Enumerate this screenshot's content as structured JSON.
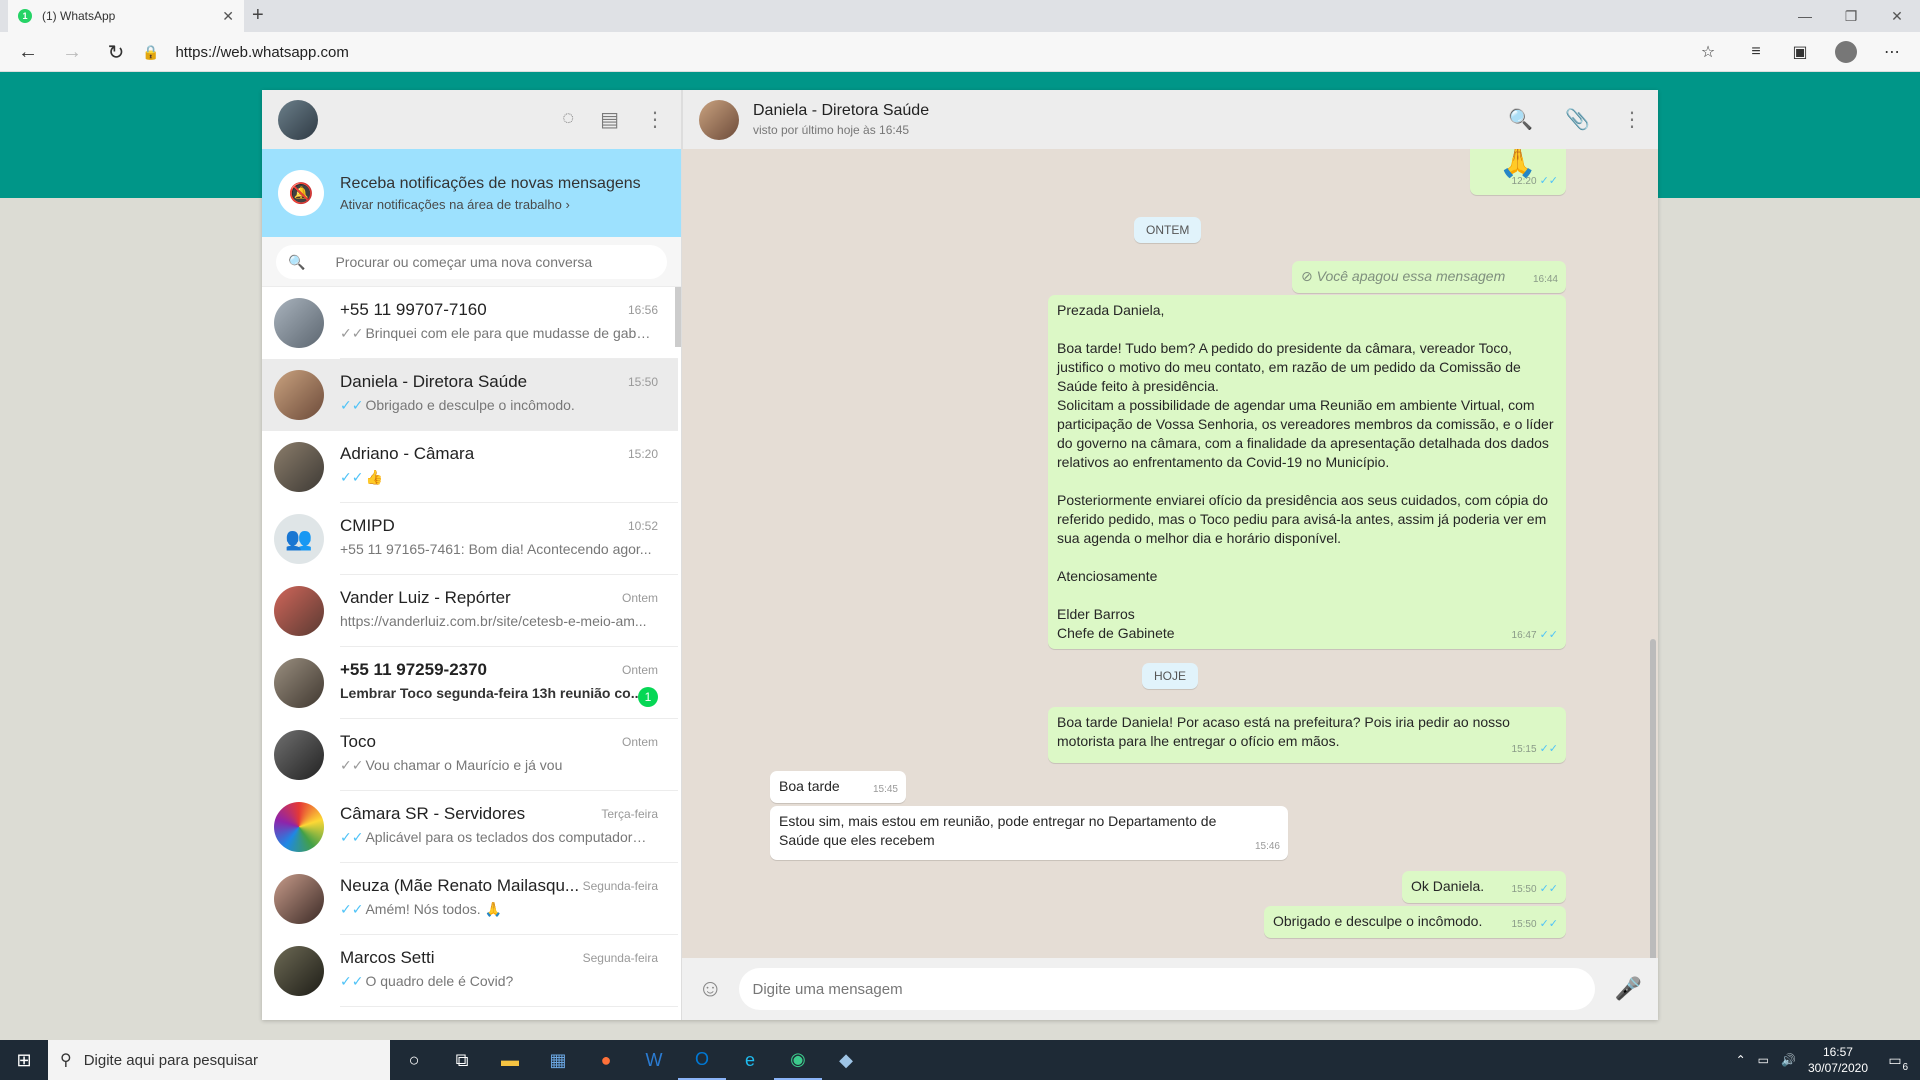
{
  "browser": {
    "tab_title": "(1) WhatsApp",
    "tab_favicon_badge": "1",
    "url": "https://web.whatsapp.com"
  },
  "sidebar": {
    "notification": {
      "title": "Receba notificações de novas mensagens",
      "subtitle": "Ativar notificações na área de trabalho ›"
    },
    "search_placeholder": "Procurar ou começar uma nova conversa",
    "chats": [
      {
        "name": "+55 11 99707-7160",
        "time": "16:56",
        "last": "Brinquei com ele para que mudasse de gabin...",
        "ticks": "✓✓",
        "ticks_color": "grey"
      },
      {
        "name": "Daniela - Diretora Saúde",
        "time": "15:50",
        "last": "Obrigado e desculpe o incômodo.",
        "ticks": "✓✓",
        "ticks_color": "blue"
      },
      {
        "name": "Adriano - Câmara",
        "time": "15:20",
        "last": "👍",
        "ticks": "✓✓",
        "ticks_color": "blue"
      },
      {
        "name": "CMIPD",
        "time": "10:52",
        "last": "+55 11 97165-7461: Bom dia! Acontecendo agor...",
        "ticks": "",
        "ticks_color": "none"
      },
      {
        "name": "Vander Luiz - Repórter",
        "time": "Ontem",
        "last": "https://vanderluiz.com.br/site/cetesb-e-meio-am...",
        "ticks": "",
        "ticks_color": "none"
      },
      {
        "name": "+55 11 97259-2370",
        "time": "Ontem",
        "last": "Lembrar Toco segunda-feira 13h reunião co...",
        "ticks": "",
        "ticks_color": "none",
        "unread": "1"
      },
      {
        "name": "Toco",
        "time": "Ontem",
        "last": "Vou chamar o Maurício e já vou",
        "ticks": "✓✓",
        "ticks_color": "grey"
      },
      {
        "name": "Câmara SR - Servidores",
        "time": "Terça-feira",
        "last": "Aplicável para os teclados dos computadores ...",
        "ticks": "✓✓",
        "ticks_color": "blue"
      },
      {
        "name": "Neuza (Mãe Renato Mailasqu...",
        "time": "Segunda-feira",
        "last": "Amém! Nós todos. 🙏",
        "ticks": "✓✓",
        "ticks_color": "blue"
      },
      {
        "name": "Marcos Setti",
        "time": "Segunda-feira",
        "last": "O quadro dele é Covid?",
        "ticks": "✓✓",
        "ticks_color": "blue"
      }
    ]
  },
  "conversation": {
    "name": "Daniela - Diretora Saúde",
    "status": "visto por último hoje às 16:45",
    "messages": {
      "emoji_msg": {
        "emoji": "🙏",
        "time": "12:20"
      },
      "day1": "ONTEM",
      "deleted": {
        "text": "Você apagou essa mensagem",
        "time": "16:44"
      },
      "long": {
        "text": "Prezada Daniela,\n\nBoa tarde! Tudo bem? A pedido do presidente da câmara, vereador Toco, justifico o motivo do meu contato, em razão de um pedido da Comissão de Saúde feito à presidência.\nSolicitam a possibilidade de agendar uma Reunião em ambiente Virtual, com participação de Vossa Senhoria, os vereadores membros da comissão, e o líder do governo na câmara, com a finalidade da apresentação detalhada dos dados relativos ao enfrentamento da Covid-19 no Município.\n\nPosteriormente enviarei ofício da presidência aos seus cuidados, com cópia do referido pedido, mas o Toco pediu para avisá-la antes, assim já poderia ver em sua agenda o melhor dia e horário disponível.\n\nAtenciosamente\n\nElder Barros\nChefe de Gabinete",
        "time": "16:47"
      },
      "day2": "HOJE",
      "out1": {
        "text": "Boa tarde Daniela! Por acaso está na prefeitura? Pois iria pedir ao nosso motorista para lhe entregar o ofício em mãos.",
        "time": "15:15"
      },
      "in1": {
        "text": "Boa tarde",
        "time": "15:45"
      },
      "in2": {
        "text": "Estou sim, mais estou em reunião,  pode entregar no Departamento de Saúde que eles recebem",
        "time": "15:46"
      },
      "out2": {
        "text": "Ok Daniela.",
        "time": "15:50"
      },
      "out3": {
        "text": "Obrigado e desculpe o incômodo.",
        "time": "15:50"
      }
    },
    "composer_placeholder": "Digite uma mensagem"
  },
  "taskbar": {
    "search_placeholder": "Digite aqui para pesquisar",
    "time": "16:57",
    "date": "30/07/2020",
    "notifications": "6"
  },
  "colors": {
    "accent": "#009688",
    "outgoing_bubble": "#dcf8c6",
    "notification_banner": "#9de1fe",
    "read_ticks": "#4fc3f7"
  }
}
